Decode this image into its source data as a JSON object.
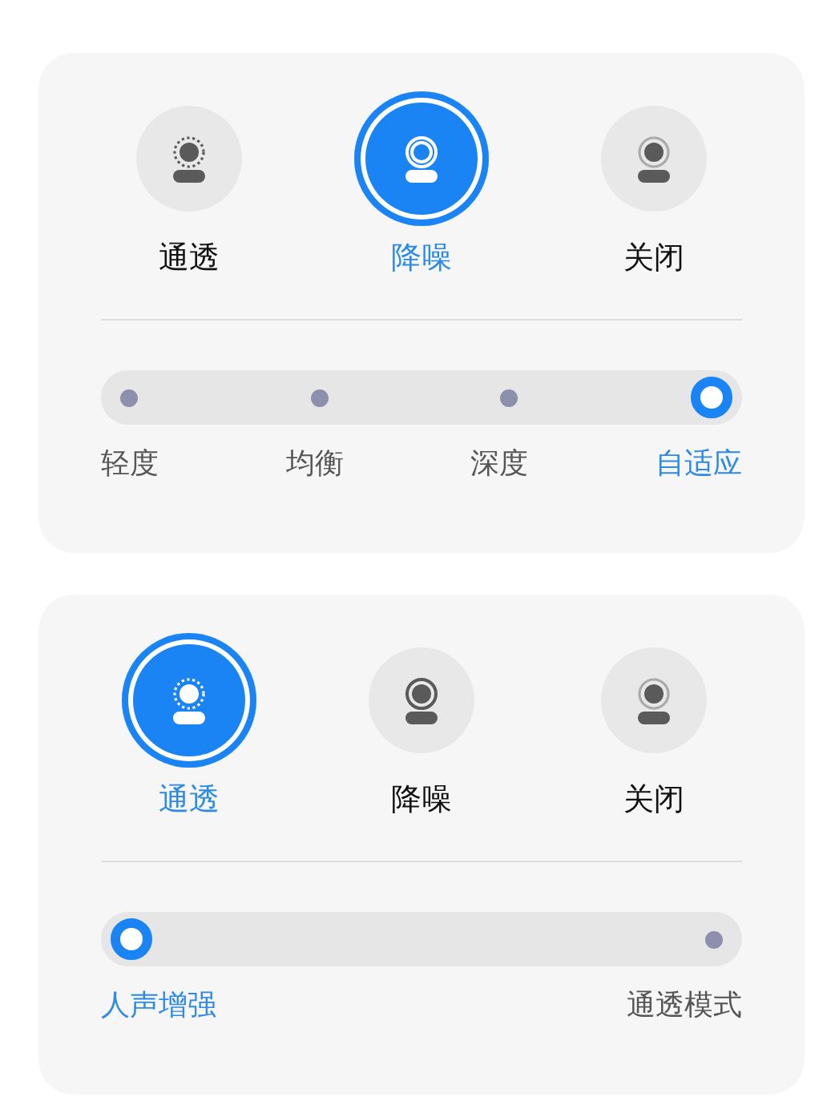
{
  "panels": [
    {
      "modes": [
        {
          "label": "通透",
          "kind": "transparency",
          "selected": false
        },
        {
          "label": "降噪",
          "kind": "noise",
          "selected": true
        },
        {
          "label": "关闭",
          "kind": "off",
          "selected": false
        }
      ],
      "levels": [
        {
          "label": "轻度",
          "selected": false
        },
        {
          "label": "均衡",
          "selected": false
        },
        {
          "label": "深度",
          "selected": false
        },
        {
          "label": "自适应",
          "selected": true
        }
      ]
    },
    {
      "modes": [
        {
          "label": "通透",
          "kind": "transparency",
          "selected": true
        },
        {
          "label": "降噪",
          "kind": "noise",
          "selected": false
        },
        {
          "label": "关闭",
          "kind": "off",
          "selected": false
        }
      ],
      "levels": [
        {
          "label": "人声增强",
          "selected": true
        },
        {
          "label": "通透模式",
          "selected": false
        }
      ]
    }
  ]
}
